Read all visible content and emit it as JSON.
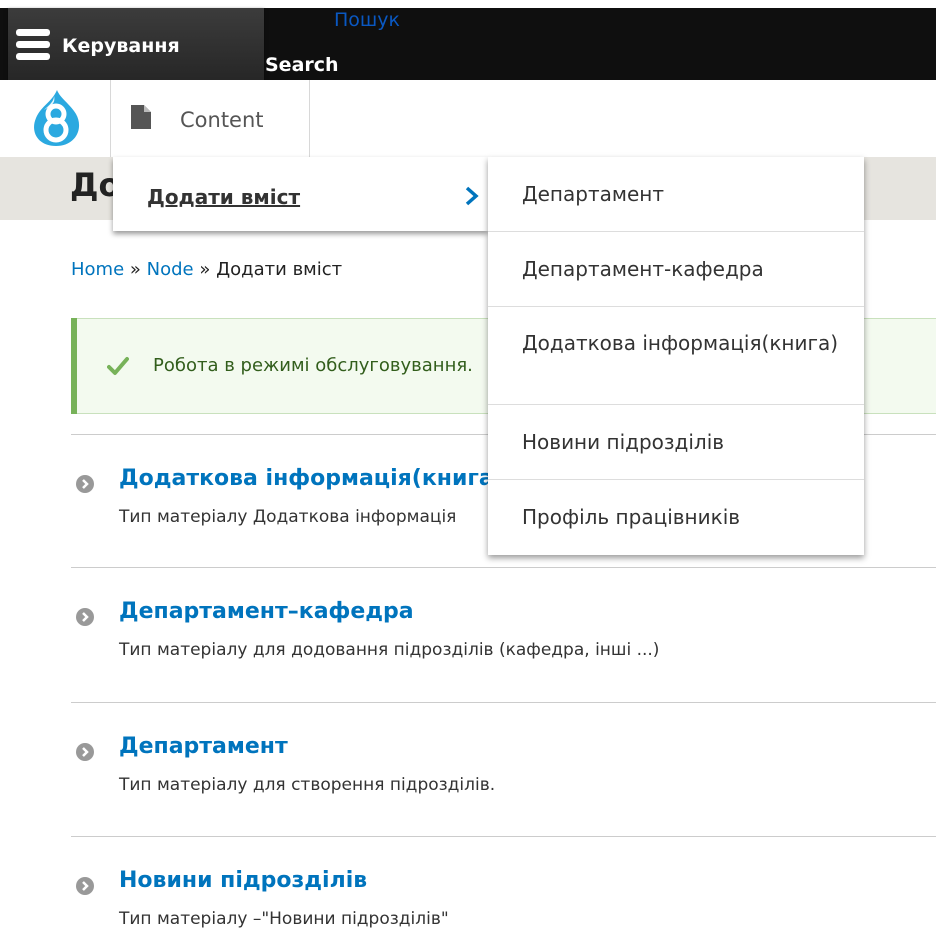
{
  "toolbar": {
    "manage_label": "Керування",
    "search_link": "Пошук",
    "search_label": "Search"
  },
  "tray": {
    "content_label": "Content"
  },
  "page": {
    "title": "Додати вміст"
  },
  "breadcrumb": {
    "items": [
      "Home",
      "Node",
      "Додати вміст"
    ],
    "separator": "»"
  },
  "status": {
    "text": "Робота в режимі обслуговування."
  },
  "content_types": [
    {
      "title": "Додаткова інформація(книга)",
      "description": "Тип матеріалу Додаткова інформація"
    },
    {
      "title": "Департамент–кафедра",
      "description": "Тип матеріалу для додовання підрозділів (кафедра, інші ...)"
    },
    {
      "title": "Департамент",
      "description": "Тип матеріалу для створення підрозділів."
    },
    {
      "title": "Новини підрозділів",
      "description": "Тип матеріалу –\"Новини підрозділів\""
    }
  ],
  "menu": {
    "level1_label": "Додати вміст",
    "submenu": [
      "Департамент",
      "Департамент-кафедра",
      "Додаткова інформація(книга)",
      "Новини підрозділів",
      "Профіль працівників"
    ]
  },
  "colors": {
    "link": "#0074bd",
    "toolbar_bg": "#0f0f0f",
    "header_band": "#e6e4df",
    "status_bg": "#f3faef",
    "status_accent": "#77b259",
    "drupal_blue": "#2ba9e0"
  },
  "icons": {
    "hamburger": "hamburger-icon",
    "logo": "drupal-logo",
    "content": "document-icon",
    "check": "check-icon",
    "chevron": "chevron-right-icon",
    "list_arrow": "arrow-circle-icon"
  }
}
